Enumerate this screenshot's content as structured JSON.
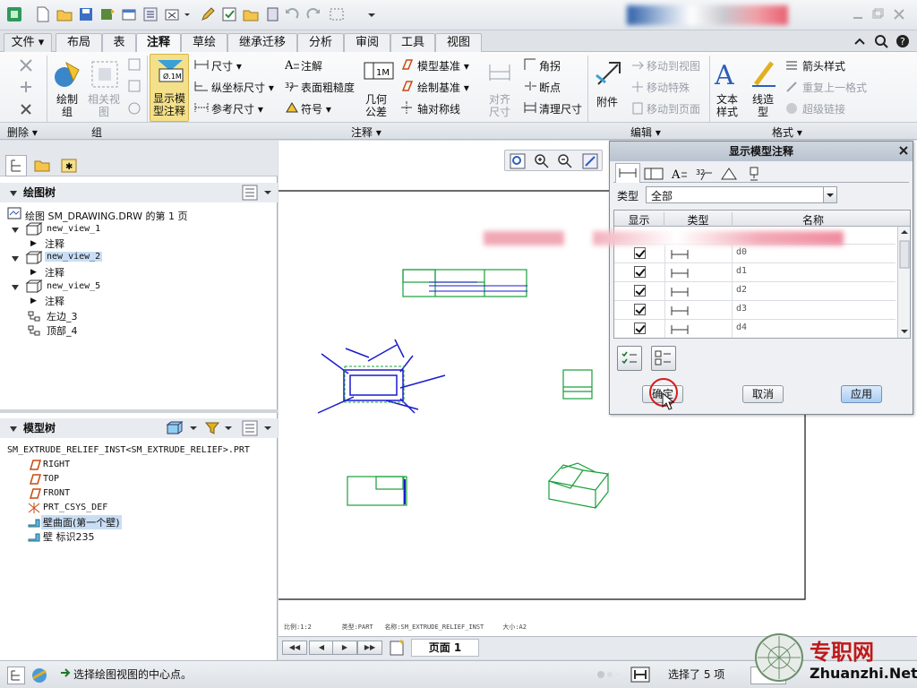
{
  "tabs": {
    "file": "文件",
    "items": [
      "布局",
      "表",
      "注释",
      "草绘",
      "继承迁移",
      "分析",
      "审阅",
      "工具",
      "视图"
    ],
    "active": "注释"
  },
  "ribbon": {
    "delete_group": {
      "label": "删除"
    },
    "group_group": {
      "draw_group": "绘制组",
      "related_view_line1": "相关视",
      "related_view_line2": "图",
      "label": "组"
    },
    "annotation": {
      "show_model_line1": "显示模",
      "show_model_line2": "型注释",
      "dimension": "尺寸",
      "ordinate_dimension": "纵坐标尺寸",
      "reference_dimension": "参考尺寸",
      "note": "注解",
      "surface_finish": "表面粗糙度",
      "symbol": "符号",
      "geom_tol_line1": "几何",
      "geom_tol_line2": "公差",
      "model_datum": "模型基准",
      "draw_datum": "绘制基准",
      "axis_symmetry": "轴对称线",
      "align_dim_line1": "对齐",
      "align_dim_line2": "尺寸",
      "angle": "角拐",
      "break": "断点",
      "clean_dim": "清理尺寸",
      "label": "注释"
    },
    "edit": {
      "attach": "附件",
      "move_to_view": "移动到视图",
      "move_special": "移动特殊",
      "move_to_page": "移动到页面",
      "label": "编辑"
    },
    "format": {
      "text_style_line1": "文本",
      "text_style_line2": "样式",
      "line_style_line1": "线造",
      "line_style_line2": "型",
      "arrow_style": "箭头样式",
      "repeat_format": "重复上一格式",
      "hyperlink": "超级链接",
      "label": "格式"
    }
  },
  "drawing_tree": {
    "title": "绘图树",
    "root": "绘图 SM_DRAWING.DRW 的第 1 页",
    "items": [
      {
        "label": "new_view_1",
        "child": "注释"
      },
      {
        "label": "new_view_2",
        "child": "注释"
      },
      {
        "label": "new_view_5",
        "child": "注释"
      }
    ],
    "extra": [
      "左边_3",
      "顶部_4"
    ]
  },
  "model_tree": {
    "title": "模型树",
    "root": "SM_EXTRUDE_RELIEF_INST<SM_EXTRUDE_RELIEF>.PRT",
    "items": [
      "RIGHT",
      "TOP",
      "FRONT",
      "PRT_CSYS_DEF",
      "壁曲面(第一个壁)",
      "壁 标识235"
    ]
  },
  "dialog": {
    "title": "显示模型注释",
    "type_label": "类型",
    "type_value": "全部",
    "columns": [
      "显示",
      "类型",
      "名称"
    ],
    "rows": [
      "d0",
      "d1",
      "d2",
      "d3",
      "d4"
    ],
    "ok": "确定",
    "cancel": "取消",
    "apply": "应用"
  },
  "canvas": {
    "info_scale": "比例:1:2",
    "info_type": "类型:PART",
    "info_name": "名称:SM_EXTRUDE_RELIEF_INST",
    "info_size": "大小:A2",
    "page_label": "页面 1"
  },
  "status": {
    "message": "选择绘图视图的中心点。",
    "selected": "选择了 5 项"
  },
  "watermark": {
    "cn": "专职网",
    "en": "Zhuanzhi.Net"
  },
  "colors": {
    "accent_blue": "#2b5fb8",
    "annotation_blue": "#1a1ad0",
    "part_green": "#18a03a",
    "ok_highlight": "#d41c1c"
  }
}
